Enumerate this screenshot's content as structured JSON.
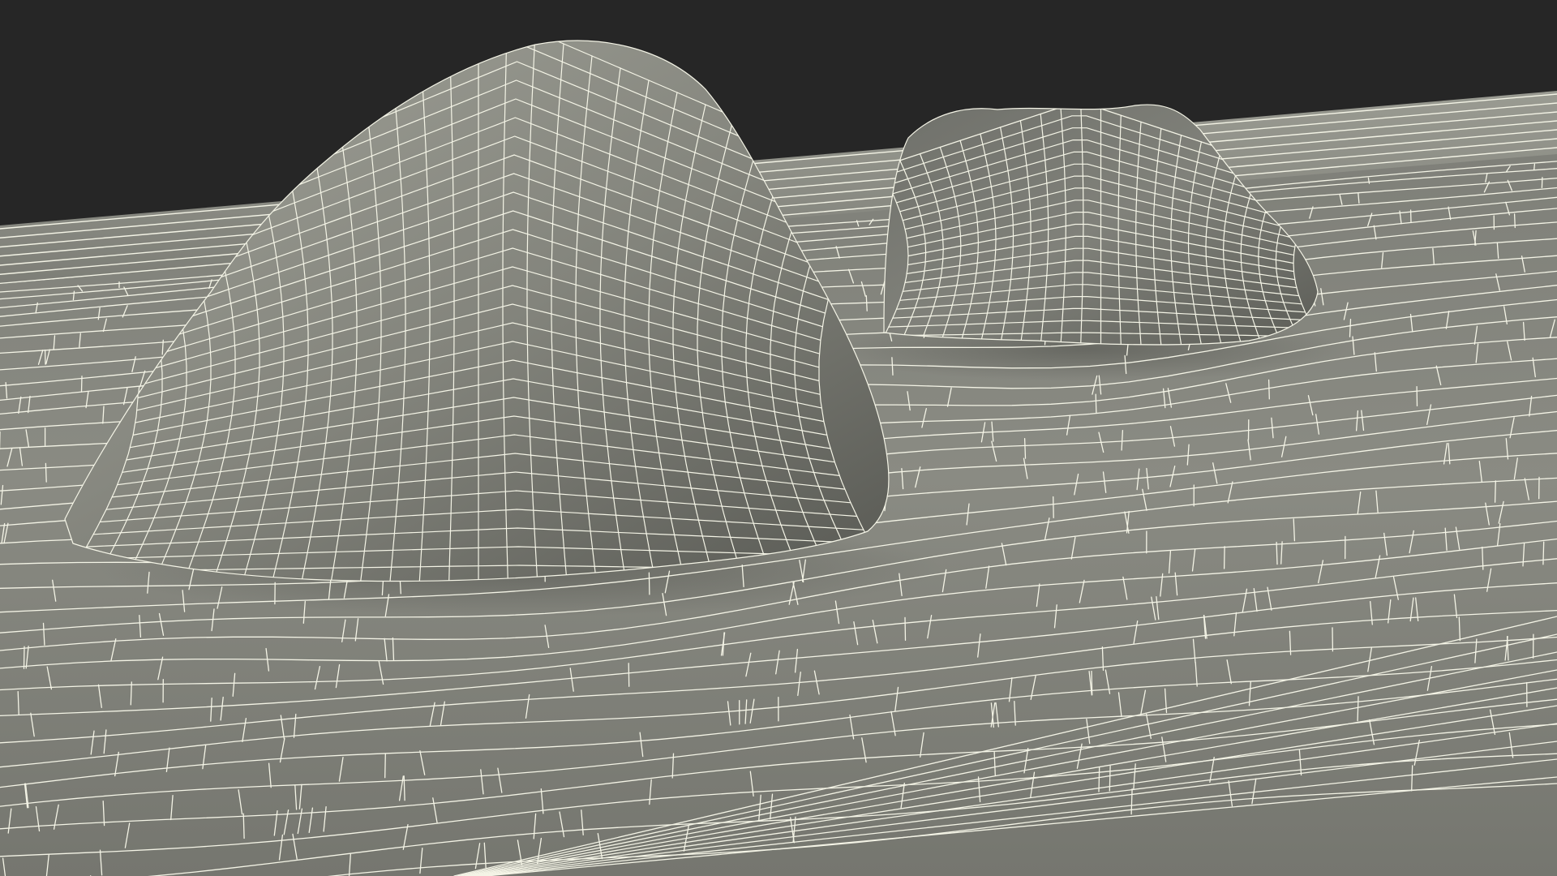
{
  "scene": {
    "kind": "3d-wireframe-render",
    "subject": "terrain-with-two-rock-formations",
    "colors": {
      "background": "#262626",
      "ground_fill_light": "#8a8a80",
      "ground_fill_dark": "#6f706a",
      "rock_fill_light": "#8c8c83",
      "rock_fill_dark": "#5e5f59",
      "wire": "#f4f4e6"
    },
    "objects": [
      "ground-plane",
      "large-rock",
      "small-rock",
      "back-ledge"
    ]
  }
}
